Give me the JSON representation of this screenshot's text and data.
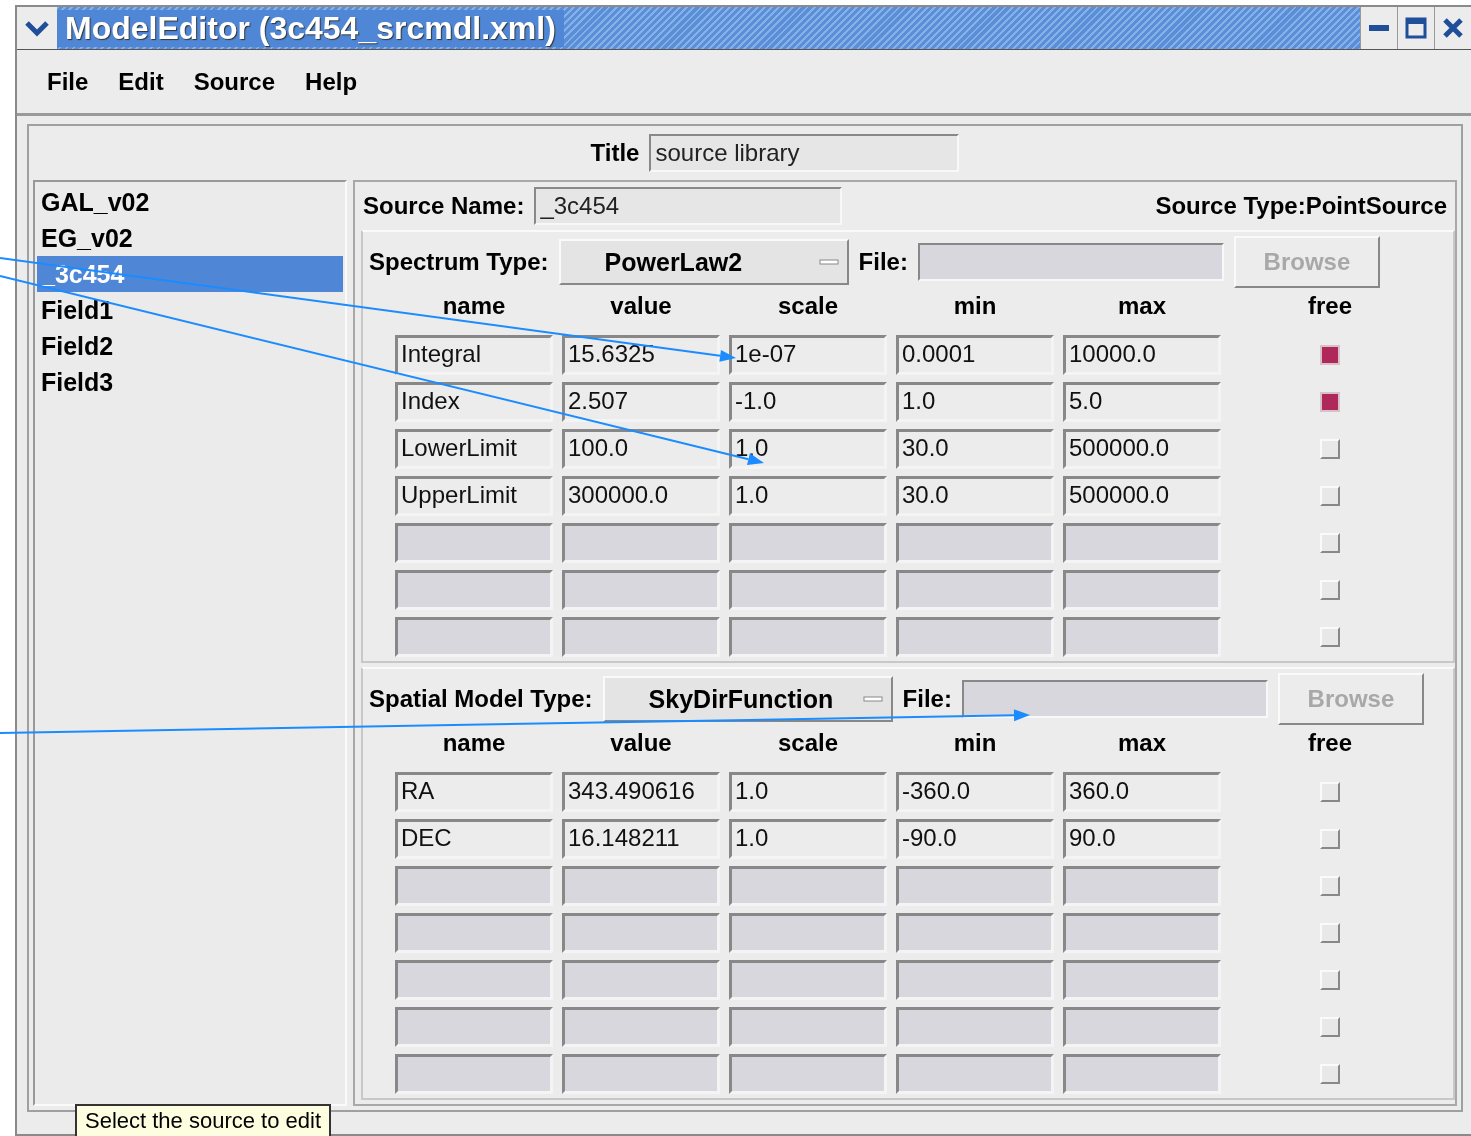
{
  "window": {
    "title": "ModelEditor (3c454_srcmdl.xml)"
  },
  "menu": [
    "File",
    "Edit",
    "Source",
    "Help"
  ],
  "title_field": {
    "label": "Title",
    "value": "source library"
  },
  "sources": [
    {
      "label": "GAL_v02",
      "selected": false
    },
    {
      "label": "EG_v02",
      "selected": false
    },
    {
      "label": "_3c454",
      "selected": true
    },
    {
      "label": "Field1",
      "selected": false
    },
    {
      "label": "Field2",
      "selected": false
    },
    {
      "label": "Field3",
      "selected": false
    }
  ],
  "source_name": {
    "label": "Source Name:",
    "value": "_3c454"
  },
  "source_type": "Source Type:PointSource",
  "sections": [
    {
      "type_label": "Spectrum Type:",
      "type_value": "PowerLaw2",
      "file_label": "File:",
      "browse": {
        "label": "Browse",
        "disabled": true
      },
      "columns": [
        "name",
        "value",
        "scale",
        "min",
        "max",
        "free"
      ],
      "rows": [
        {
          "cells": [
            "Integral",
            "15.6325",
            "1e-07",
            "0.0001",
            "10000.0"
          ],
          "free": true,
          "disabled": false
        },
        {
          "cells": [
            "Index",
            "2.507",
            "-1.0",
            "1.0",
            "5.0"
          ],
          "free": true,
          "disabled": false
        },
        {
          "cells": [
            "LowerLimit",
            "100.0",
            "1.0",
            "30.0",
            "500000.0"
          ],
          "free": false,
          "disabled": false
        },
        {
          "cells": [
            "UpperLimit",
            "300000.0",
            "1.0",
            "30.0",
            "500000.0"
          ],
          "free": false,
          "disabled": false
        },
        {
          "free": false,
          "disabled": true
        },
        {
          "free": false,
          "disabled": true
        },
        {
          "free": false,
          "disabled": true
        }
      ]
    },
    {
      "type_label": "Spatial Model Type:",
      "type_value": "SkyDirFunction",
      "file_label": "File:",
      "browse": {
        "label": "Browse",
        "disabled": true
      },
      "columns": [
        "name",
        "value",
        "scale",
        "min",
        "max",
        "free"
      ],
      "rows": [
        {
          "cells": [
            "RA",
            "343.490616",
            "1.0",
            "-360.0",
            "360.0"
          ],
          "free": false,
          "disabled": false
        },
        {
          "cells": [
            "DEC",
            "16.148211",
            "1.0",
            "-90.0",
            "90.0"
          ],
          "free": false,
          "disabled": false
        },
        {
          "free": false,
          "disabled": true
        },
        {
          "free": false,
          "disabled": true
        },
        {
          "free": false,
          "disabled": true
        },
        {
          "free": false,
          "disabled": true
        },
        {
          "free": false,
          "disabled": true
        }
      ]
    }
  ],
  "tooltip": "Select the source to edit"
}
